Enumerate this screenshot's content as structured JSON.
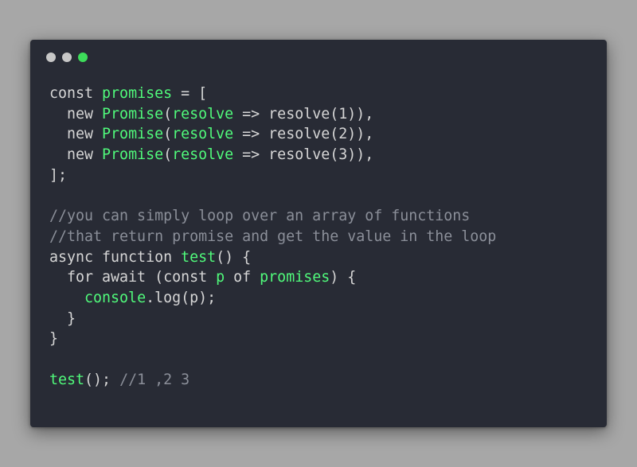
{
  "window": {
    "controls": [
      {
        "name": "close-dot",
        "color": "#c7c7c7"
      },
      {
        "name": "minimize-dot",
        "color": "#c7c7c7"
      },
      {
        "name": "maximize-dot",
        "color": "#3ddc5a"
      }
    ]
  },
  "colors": {
    "background": "#a7a7a7",
    "window": "#282b35",
    "plain": "#d6d6d6",
    "green": "#50fa7b",
    "comment": "#8b8f99"
  },
  "code": {
    "lines": [
      [
        {
          "t": "const ",
          "c": "plain"
        },
        {
          "t": "promises",
          "c": "green"
        },
        {
          "t": " = [",
          "c": "plain"
        }
      ],
      [
        {
          "t": "  new ",
          "c": "plain"
        },
        {
          "t": "Promise",
          "c": "green"
        },
        {
          "t": "(",
          "c": "plain"
        },
        {
          "t": "resolve",
          "c": "green"
        },
        {
          "t": " => resolve(1)),",
          "c": "plain"
        }
      ],
      [
        {
          "t": "  new ",
          "c": "plain"
        },
        {
          "t": "Promise",
          "c": "green"
        },
        {
          "t": "(",
          "c": "plain"
        },
        {
          "t": "resolve",
          "c": "green"
        },
        {
          "t": " => resolve(2)),",
          "c": "plain"
        }
      ],
      [
        {
          "t": "  new ",
          "c": "plain"
        },
        {
          "t": "Promise",
          "c": "green"
        },
        {
          "t": "(",
          "c": "plain"
        },
        {
          "t": "resolve",
          "c": "green"
        },
        {
          "t": " => resolve(3)),",
          "c": "plain"
        }
      ],
      [
        {
          "t": "];",
          "c": "plain"
        }
      ],
      [],
      [
        {
          "t": "//you can simply loop over an array of functions",
          "c": "comment"
        }
      ],
      [
        {
          "t": "//that return promise and get the value in the loop",
          "c": "comment"
        }
      ],
      [
        {
          "t": "async function ",
          "c": "plain"
        },
        {
          "t": "test",
          "c": "green"
        },
        {
          "t": "() {",
          "c": "plain"
        }
      ],
      [
        {
          "t": "  for await (const ",
          "c": "plain"
        },
        {
          "t": "p",
          "c": "green"
        },
        {
          "t": " of ",
          "c": "plain"
        },
        {
          "t": "promises",
          "c": "green"
        },
        {
          "t": ") {",
          "c": "plain"
        }
      ],
      [
        {
          "t": "    ",
          "c": "plain"
        },
        {
          "t": "console",
          "c": "green"
        },
        {
          "t": ".log(p);",
          "c": "plain"
        }
      ],
      [
        {
          "t": "  }",
          "c": "plain"
        }
      ],
      [
        {
          "t": "}",
          "c": "plain"
        }
      ],
      [],
      [
        {
          "t": "test",
          "c": "green"
        },
        {
          "t": "(); ",
          "c": "plain"
        },
        {
          "t": "//1 ,2 3",
          "c": "comment"
        }
      ]
    ]
  }
}
